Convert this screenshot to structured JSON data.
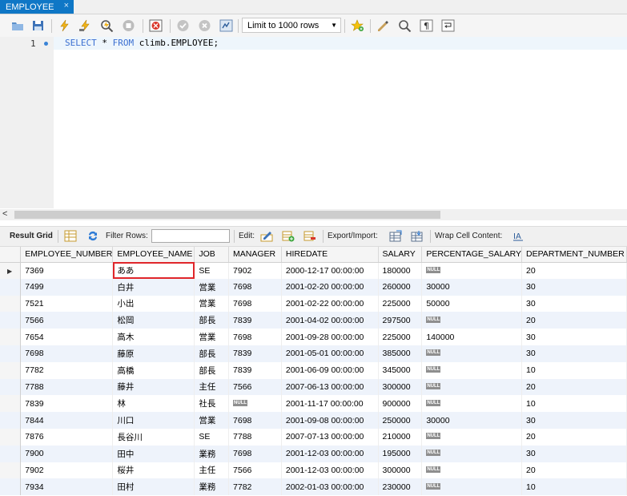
{
  "tab": {
    "title": "EMPLOYEE",
    "close": "×"
  },
  "toolbar": {
    "limit_value": "Limit to 1000 rows",
    "icons": [
      "open-file-icon",
      "save-icon",
      "execute-icon",
      "execute-current-icon",
      "explain-icon",
      "stop-icon",
      "toggle-error-icon",
      "commit-icon",
      "rollback-icon",
      "autocommit-icon",
      "bookmark-star-icon",
      "beautify-icon",
      "find-icon",
      "invisible-chars-icon",
      "wrap-icon"
    ]
  },
  "editor": {
    "line_number": "1",
    "code": {
      "kw1": "SELECT",
      "mid": " * ",
      "kw2": "FROM",
      "rest": " climb.EMPLOYEE;"
    }
  },
  "results_toolbar": {
    "result_grid": "Result Grid",
    "filter_rows": "Filter Rows:",
    "edit": "Edit:",
    "export_import": "Export/Import:",
    "wrap_cell": "Wrap Cell Content:"
  },
  "grid": {
    "columns": [
      "EMPLOYEE_NUMBER",
      "EMPLOYEE_NAME",
      "JOB",
      "MANAGER",
      "HIREDATE",
      "SALARY",
      "PERCENTAGE_SALARY",
      "DEPARTMENT_NUMBER"
    ],
    "null_label": "NULL",
    "rows": [
      [
        "7369",
        "ああ",
        "SE",
        "7902",
        "2000-12-17 00:00:00",
        "180000",
        null,
        "20"
      ],
      [
        "7499",
        "白井",
        "営業",
        "7698",
        "2001-02-20 00:00:00",
        "260000",
        "30000",
        "30"
      ],
      [
        "7521",
        "小出",
        "営業",
        "7698",
        "2001-02-22 00:00:00",
        "225000",
        "50000",
        "30"
      ],
      [
        "7566",
        "松岡",
        "部長",
        "7839",
        "2001-04-02 00:00:00",
        "297500",
        null,
        "20"
      ],
      [
        "7654",
        "高木",
        "営業",
        "7698",
        "2001-09-28 00:00:00",
        "225000",
        "140000",
        "30"
      ],
      [
        "7698",
        "藤原",
        "部長",
        "7839",
        "2001-05-01 00:00:00",
        "385000",
        null,
        "30"
      ],
      [
        "7782",
        "高橋",
        "部長",
        "7839",
        "2001-06-09 00:00:00",
        "345000",
        null,
        "10"
      ],
      [
        "7788",
        "藤井",
        "主任",
        "7566",
        "2007-06-13 00:00:00",
        "300000",
        null,
        "20"
      ],
      [
        "7839",
        "林",
        "社長",
        null,
        "2001-11-17 00:00:00",
        "900000",
        null,
        "10"
      ],
      [
        "7844",
        "川口",
        "営業",
        "7698",
        "2001-09-08 00:00:00",
        "250000",
        "30000",
        "30"
      ],
      [
        "7876",
        "長谷川",
        "SE",
        "7788",
        "2007-07-13 00:00:00",
        "210000",
        null,
        "20"
      ],
      [
        "7900",
        "田中",
        "業務",
        "7698",
        "2001-12-03 00:00:00",
        "195000",
        null,
        "30"
      ],
      [
        "7902",
        "桜井",
        "主任",
        "7566",
        "2001-12-03 00:00:00",
        "300000",
        null,
        "20"
      ],
      [
        "7934",
        "田村",
        "業務",
        "7782",
        "2002-01-03 00:00:00",
        "230000",
        null,
        "10"
      ]
    ]
  }
}
